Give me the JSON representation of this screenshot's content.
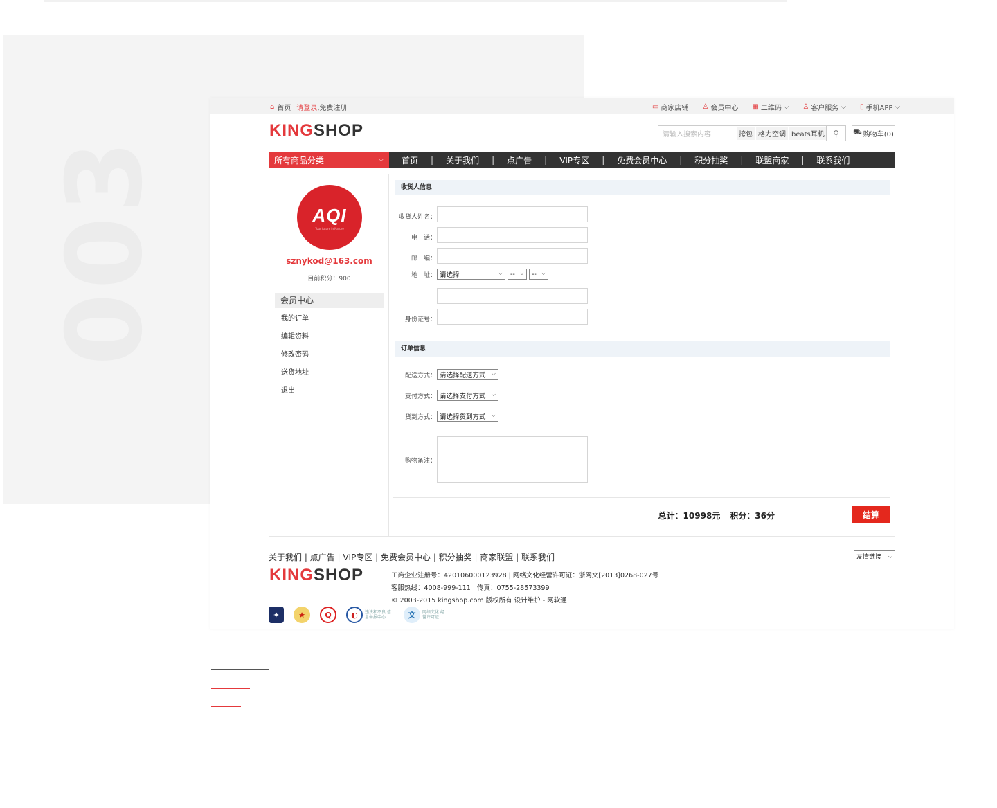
{
  "section_number": "003",
  "topbar": {
    "home": "首页",
    "login": "请登录",
    "register": ",免费注册",
    "merchant_store": "商家店铺",
    "member_center": "会员中心",
    "qrcode": "二维码",
    "customer_service": "客户服务",
    "mobile_app": "手机APP"
  },
  "logo": {
    "king": "KING",
    "shop": "SHOP"
  },
  "search": {
    "placeholder": "请输入搜索内容",
    "hot_words": [
      "挎包",
      "格力空调",
      "beats耳机"
    ]
  },
  "cart": {
    "label": "购物车(0)"
  },
  "nav": {
    "category": "所有商品分类",
    "items": [
      "首页",
      "关于我们",
      "点广告",
      "VIP专区",
      "免费会员中心",
      "积分抽奖",
      "联盟商家",
      "联系我们"
    ]
  },
  "sidebar": {
    "avatar_text": "AQI",
    "avatar_tagline": "Your future in Nature",
    "email": "sznykod@163.com",
    "points": "目前积分：900",
    "menu_title": "会员中心",
    "menu": [
      "我的订单",
      "编辑资料",
      "修改密码",
      "送货地址",
      "退出"
    ]
  },
  "receiver": {
    "title": "收货人信息",
    "name_label": "收货人姓名：",
    "phone_label": "电　话：",
    "zip_label": "邮　编：",
    "address_label": "地　址：",
    "province": "请选择",
    "city": "--",
    "district": "--",
    "id_label": "身份证号："
  },
  "order": {
    "title": "订单信息",
    "delivery_label": "配送方式：",
    "delivery_value": "请选择配送方式",
    "payment_label": "支付方式：",
    "payment_value": "请选择支付方式",
    "arrival_label": "货到方式：",
    "arrival_value": "请选择货到方式",
    "note_label": "购物备注："
  },
  "summary": {
    "total": "总计：10998元",
    "points": "积分：36分",
    "checkout": "结算"
  },
  "footer": {
    "links": "关于我们 | 点广告 | VIP专区 | 免费会员中心 | 积分抽奖 | 商家联盟 | 联系我们",
    "friend_links": "友情链接",
    "line1": "工商企业注册号：420106000123928 | 网络文化经营许可证：浙网文[2013]0268-027号",
    "line2": "客服热线：4008-999-111 | 传真：0755-28573399",
    "line3": "© 2003-2015 kingshop.com 版权所有 设计维护 - 网软通",
    "badge4": "违法和不良 信息举报中心",
    "badge5": "网络文化 经营许可证"
  },
  "colors": {
    "brand_red": "#e4393c",
    "nav_dark": "#333333",
    "checkout_red": "#e4281d"
  }
}
